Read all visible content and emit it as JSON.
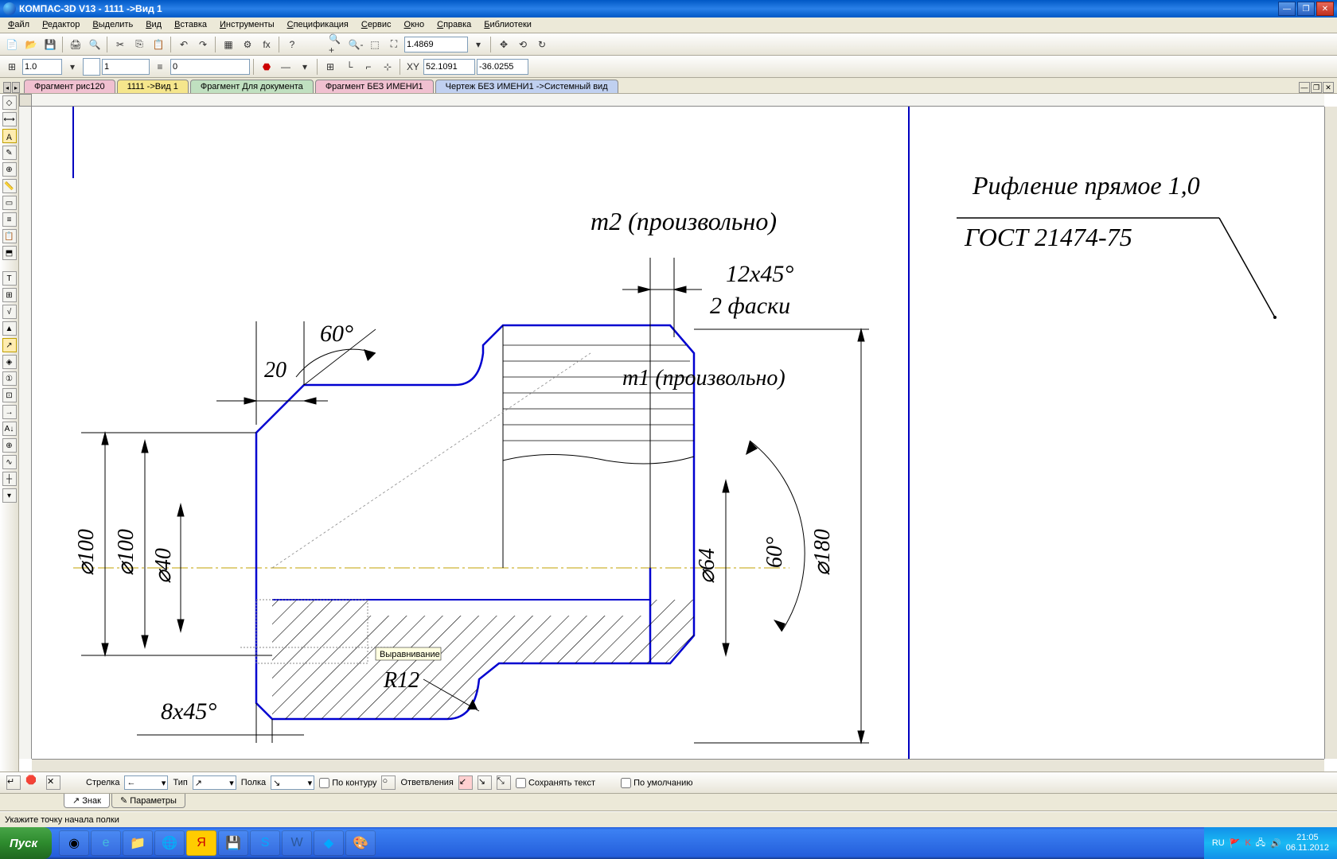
{
  "app": {
    "title": "КОМПАС-3D V13 - 1111 ->Вид 1"
  },
  "menu": [
    "Файл",
    "Редактор",
    "Выделить",
    "Вид",
    "Вставка",
    "Инструменты",
    "Спецификация",
    "Сервис",
    "Окно",
    "Справка",
    "Библиотеки"
  ],
  "top_toolbar": {
    "zoom": "1.4869",
    "coord_x": "52.1091",
    "coord_y": "-36.0255"
  },
  "second_toolbar": {
    "field1": "1.0",
    "field2": "1",
    "field3": "0"
  },
  "doc_tabs": [
    {
      "label": "Фрагмент рис120",
      "color": "pink"
    },
    {
      "label": "1111 ->Вид 1",
      "color": "yellow",
      "active": true
    },
    {
      "label": "Фрагмент Для документа",
      "color": "green"
    },
    {
      "label": "Фрагмент БЕЗ ИМЕНИ1",
      "color": "pink"
    },
    {
      "label": "Чертеж БЕЗ ИМЕНИ1 ->Системный вид",
      "color": "blue"
    }
  ],
  "drawing": {
    "note_t2": "т2 (произвольно)",
    "note_t1": "т1 (произвольно)",
    "angle60_1": "60°",
    "dim20": "20",
    "chamfer12": "12x45°",
    "chamfer12_sub": "2 фаски",
    "d100a": "⌀100",
    "d100b": "⌀100",
    "d40": "⌀40",
    "d64": "⌀64",
    "angle60_2": "60°",
    "d180": "⌀180",
    "chamfer8": "8x45°",
    "r12": "R12",
    "tooltip": "Выравнивание",
    "leader1": "Рифление прямое 1,0",
    "leader2": "ГОСТ 21474-75"
  },
  "prop_bar": {
    "arrow": "Стрелка",
    "type": "Тип",
    "shelf": "Полка",
    "contour": "По контуру",
    "branches": "Ответвления",
    "save_text": "Сохранять текст",
    "default": "По умолчанию"
  },
  "prop_tabs": {
    "sign": "Знак",
    "params": "Параметры"
  },
  "status": "Укажите точку начала полки",
  "taskbar": {
    "start": "Пуск",
    "lang": "RU",
    "time": "21:05",
    "date": "06.11.2012"
  }
}
